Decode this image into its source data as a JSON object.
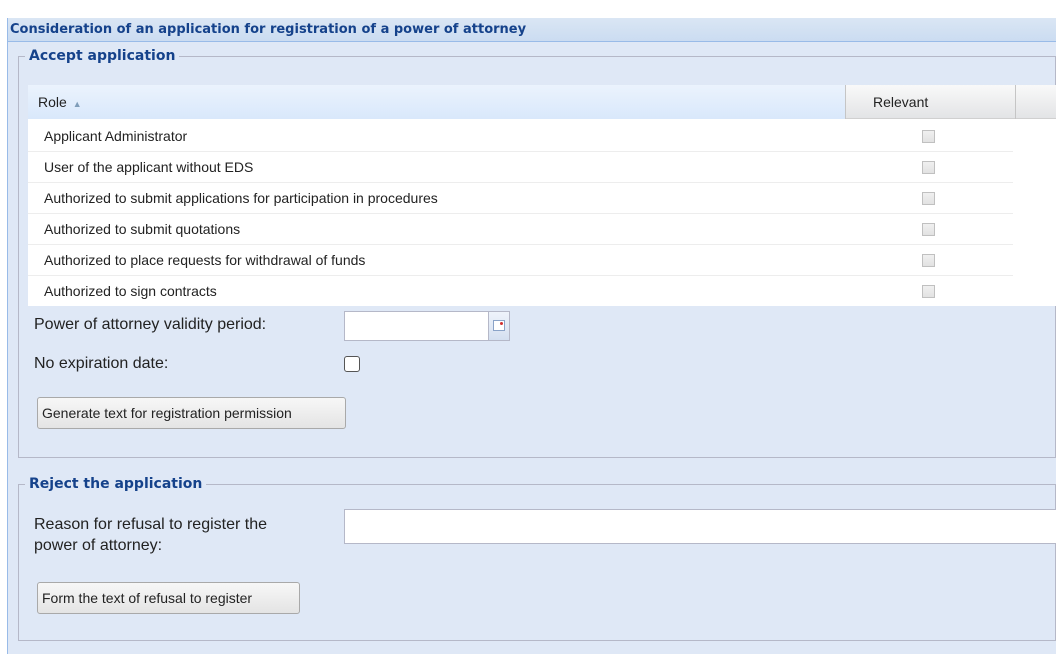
{
  "panel": {
    "title": "Consideration of an application for registration of a power of attorney"
  },
  "accept": {
    "legend": "Accept application",
    "grid": {
      "columns": {
        "role": "Role",
        "relevant": "Relevant"
      },
      "rows": [
        {
          "role": "Applicant Administrator",
          "relevant": false
        },
        {
          "role": "User of the applicant without EDS",
          "relevant": false
        },
        {
          "role": "Authorized to submit applications for participation in procedures",
          "relevant": false
        },
        {
          "role": "Authorized to submit quotations",
          "relevant": false
        },
        {
          "role": "Authorized to place requests for withdrawal of funds",
          "relevant": false
        },
        {
          "role": "Authorized to sign contracts",
          "relevant": false
        }
      ]
    },
    "validity_label": "Power of attorney validity period:",
    "validity_value": "",
    "no_expiration_label": "No expiration date:",
    "no_expiration_checked": false,
    "generate_button": "Generate text for registration permission"
  },
  "reject": {
    "legend": "Reject the application",
    "reason_label_line1": "Reason for refusal to register the",
    "reason_label_line2": "power of attorney:",
    "reason_value": "",
    "form_button": "Form the text of refusal to register"
  },
  "icons": {
    "sort": "sort-ascending-icon",
    "date_trigger": "calendar-icon"
  },
  "colors": {
    "header_text": "#15428b",
    "panel_bg": "#dfe8f6",
    "border": "#99bbe8"
  }
}
